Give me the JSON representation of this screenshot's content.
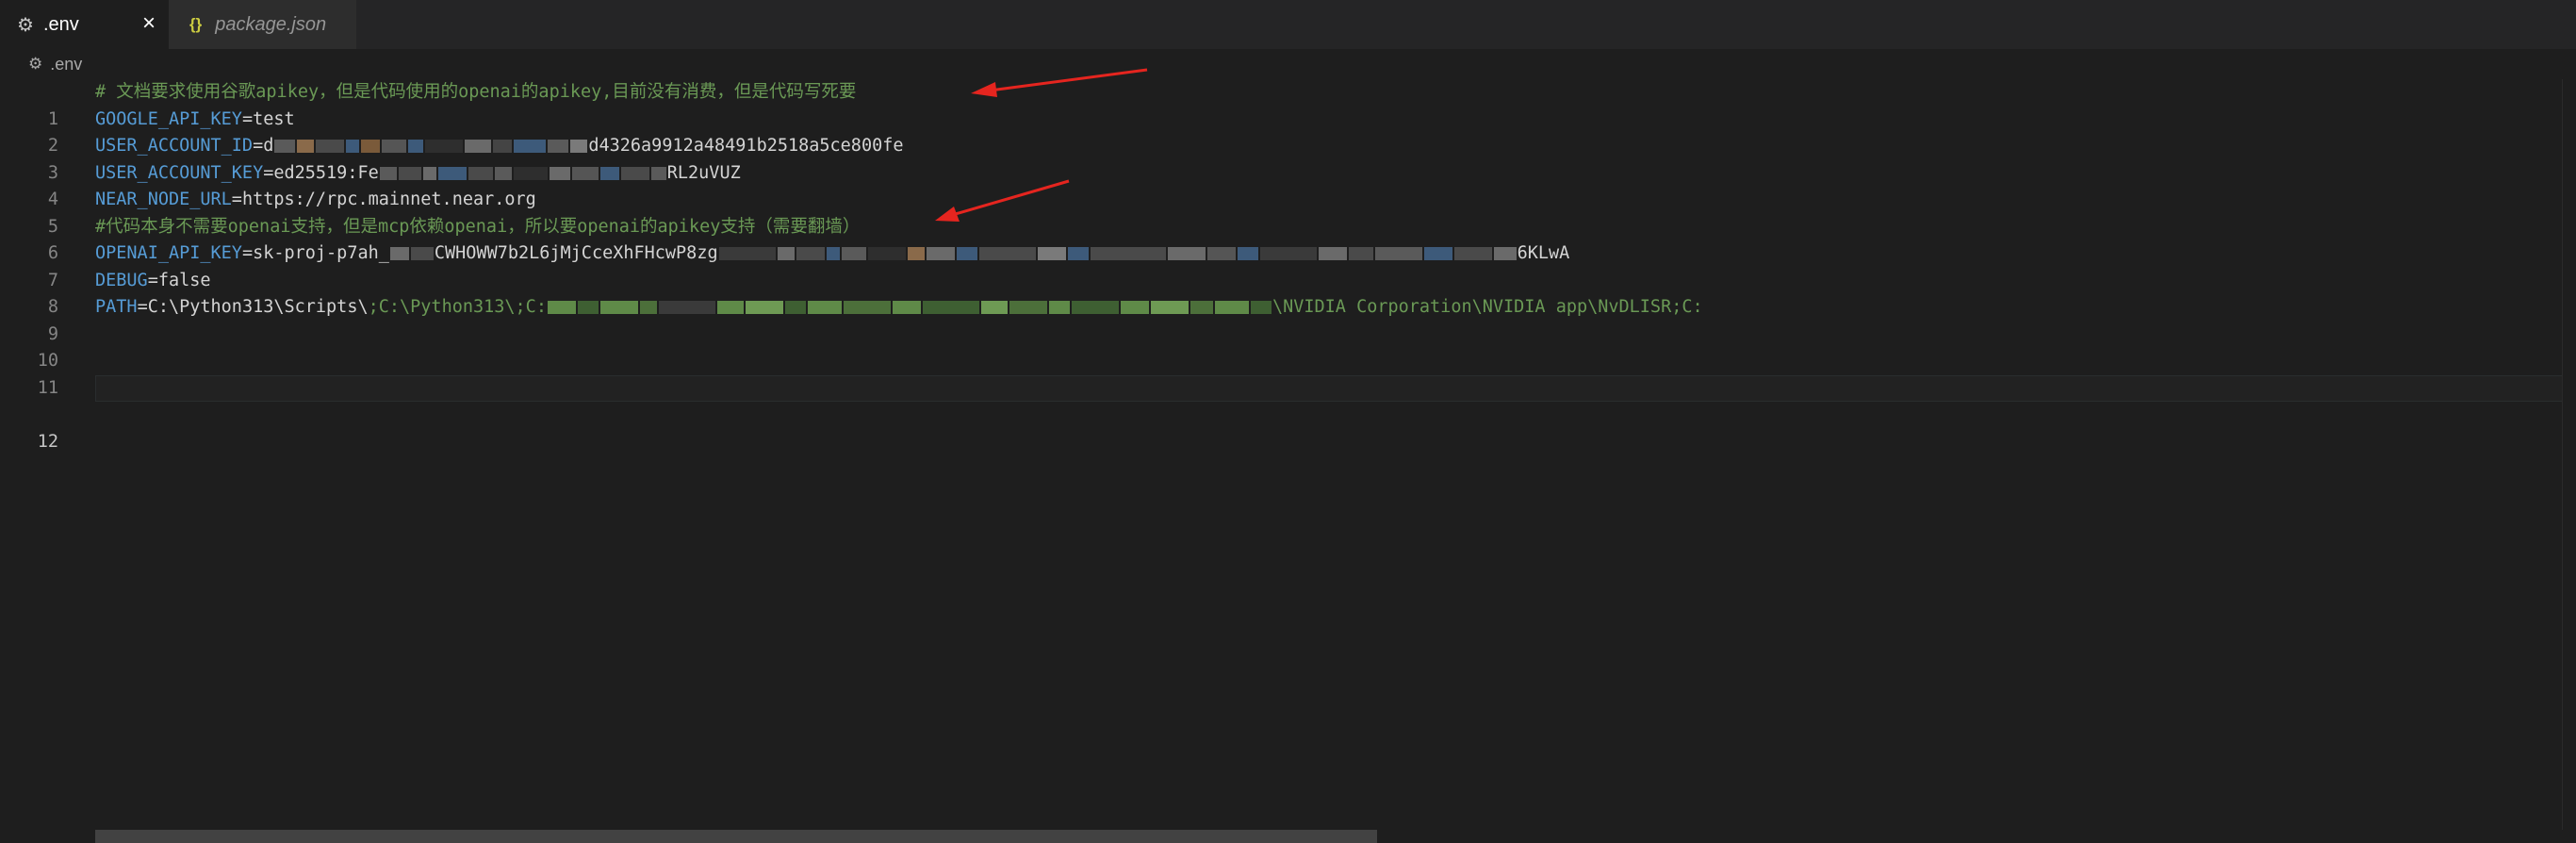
{
  "tabs": [
    {
      "label": ".env",
      "icon": "gear-icon",
      "active": true,
      "close_label": "×"
    },
    {
      "label": "package.json",
      "icon": "json-braces-icon",
      "active": false,
      "icon_glyph": "{}"
    }
  ],
  "breadcrumb": {
    "file": ".env",
    "icon": "gear-icon"
  },
  "lines": [
    {
      "num": "1",
      "comment": "# 文档要求使用谷歌apikey，但是代码使用的openai的apikey,目前没有消费，但是代码写死要"
    },
    {
      "num": "2",
      "key": "GOOGLE_API_KEY",
      "op": "=",
      "value": "test"
    },
    {
      "num": "3",
      "key": "USER_ACCOUNT_ID",
      "op": "=",
      "value_prefix": "d",
      "value_suffix": "d4326a9912a48491b2518a5ce800fe"
    },
    {
      "num": "4",
      "key": "USER_ACCOUNT_KEY",
      "op": "=",
      "value_prefix": "ed25519:Fe",
      "value_suffix": "RL2uVUZ"
    },
    {
      "num": "5",
      "key": "NEAR_NODE_URL",
      "op": "=",
      "value": "https://rpc.mainnet.near.org"
    },
    {
      "num": "6",
      "comment": "#代码本身不需要openai支持，但是mcp依赖openai，所以要openai的apikey支持（需要翻墙）"
    },
    {
      "num": "7",
      "key": "OPENAI_API_KEY",
      "op": "=",
      "value_prefix": "sk-proj-p7ah_",
      "value_mid": "CWHOWW7b2L6jMjCceXhFHcwP8zg",
      "value_suffix": "6KLwA"
    },
    {
      "num": "8",
      "key": "DEBUG",
      "op": "=",
      "value": "false"
    },
    {
      "num": "9",
      "key": "PATH",
      "op": "=",
      "value_prefix": "C:\\Python313\\Scripts\\",
      "value_mid": ";C:\\Python313\\;C:",
      "value_suffix": "\\NVIDIA Corporation\\NVIDIA app\\NvDLISR;C:"
    },
    {
      "num": "10"
    },
    {
      "num": "11"
    },
    {
      "num": "12",
      "current": true
    }
  ],
  "colors": {
    "background": "#1e1e1e",
    "comment": "#6a9955",
    "key": "#569cd6",
    "text": "#d4d4d4",
    "line_number": "#858585",
    "annotation_arrow": "#e5251f"
  }
}
